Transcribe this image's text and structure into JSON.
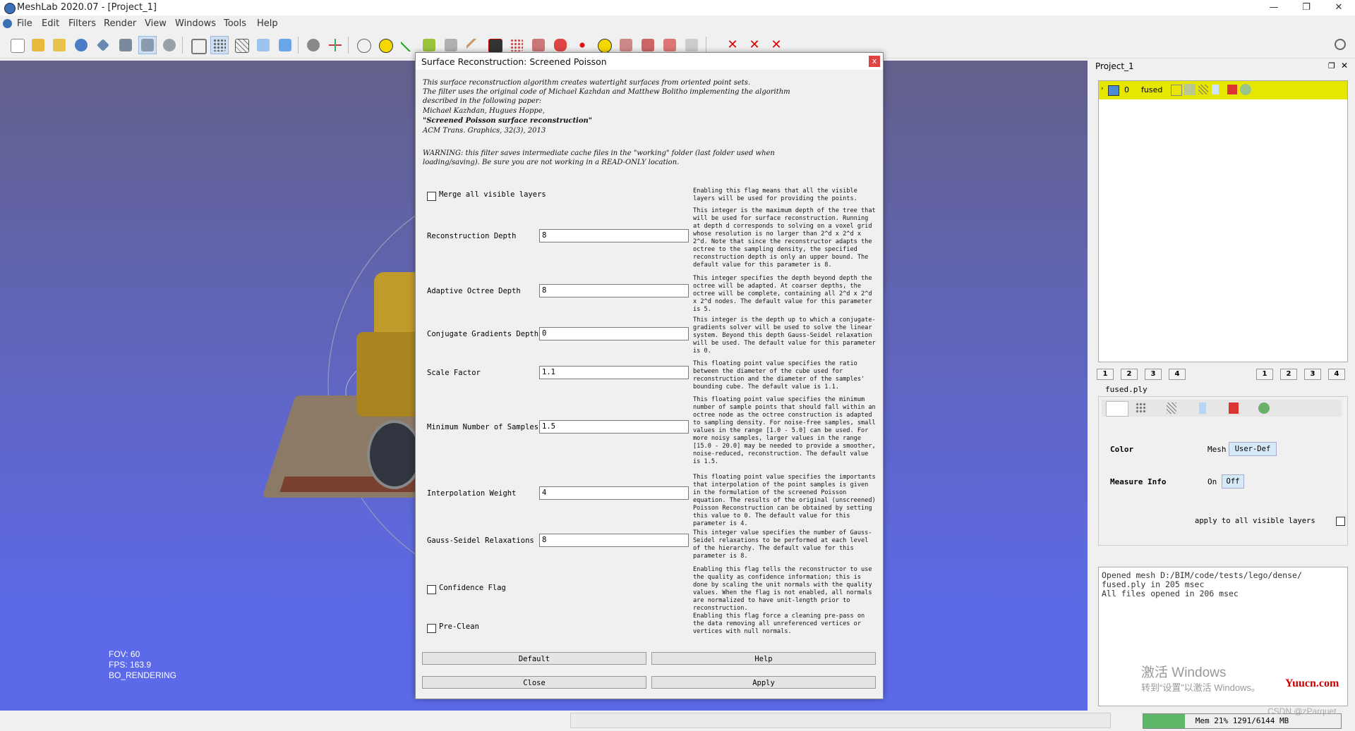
{
  "window": {
    "title": "MeshLab 2020.07 - [Project_1]",
    "min": "—",
    "max": "❐",
    "close": "✕"
  },
  "menu": [
    "File",
    "Edit",
    "Filters",
    "Render",
    "View",
    "Windows",
    "Tools",
    "Help"
  ],
  "viewport": {
    "fov": "FOV: 60",
    "fps": "FPS:  163.9",
    "mode": "BO_RENDERING"
  },
  "project": {
    "title": "Project_1",
    "layer_index": "0",
    "layer_name": "fused",
    "mesh_file": "fused.ply",
    "num_buttons": [
      "1",
      "2",
      "3",
      "4"
    ],
    "color_label": "Color",
    "color_mode": "Mesh",
    "color_value": "User-Def",
    "measure_label": "Measure Info",
    "measure_on": "On",
    "measure_off": "Off",
    "apply_all": "apply to all visible layers"
  },
  "log": [
    "Opened mesh D:/BIM/code/tests/lego/dense/",
    "fused.ply in 205 msec",
    "All files opened in 206 msec"
  ],
  "watermark": {
    "line1": "激活 Windows",
    "line2": "转到“设置”以激活 Windows。",
    "site": "Yuucn.com",
    "author": "CSDN @zParquet"
  },
  "status": {
    "mem": "Mem 21% 1291/6144 MB",
    "mem_fraction": 0.21
  },
  "dialog": {
    "title": "Surface Reconstruction: Screened Poisson",
    "close": "x",
    "description": [
      "This surface reconstruction algorithm creates watertight surfaces from oriented point sets.",
      "The filter uses the original code of Michael Kazhdan and Matthew Bolitho implementing the algorithm",
      "described in the following paper:",
      "Michael Kazhdan, Hugues Hoppe,",
      "\"Screened Poisson surface reconstruction\"",
      "ACM Trans. Graphics, 32(3), 2013"
    ],
    "warning": [
      "WARNING: this filter saves intermediate cache files in the \"working\" folder (last folder used when",
      "loading/saving). Be sure you are not working in a READ-ONLY location."
    ],
    "params": [
      {
        "kind": "check",
        "label": "Merge all visible layers",
        "checked": false,
        "help": "Enabling this flag means that all the visible layers will be used for providing the points."
      },
      {
        "kind": "input",
        "label": "Reconstruction Depth",
        "value": "8",
        "help": "This integer is the maximum depth of the tree that will be used for surface reconstruction. Running at depth d corresponds to solving on a voxel grid whose resolution is no larger than 2^d x 2^d x 2^d. Note that since the reconstructor adapts the octree to the sampling density, the specified reconstruction depth is only an upper bound. The default value for this parameter is 8."
      },
      {
        "kind": "input",
        "label": "Adaptive Octree Depth",
        "value": "8",
        "help": "This integer specifies the depth beyond depth the octree will be adapted. At coarser depths, the octree will be complete, containing all 2^d x 2^d x 2^d nodes. The default value for this parameter is 5."
      },
      {
        "kind": "input",
        "label": "Conjugate Gradients Depth",
        "value": "0",
        "help": "This integer is the depth up to which a conjugate-gradients solver will be used to solve the linear system. Beyond this depth Gauss-Seidel relaxation will be used. The default value for this parameter is 0."
      },
      {
        "kind": "input",
        "label": "Scale Factor",
        "value": "1.1",
        "help": "This floating point value specifies the ratio between the diameter of the cube used for reconstruction and the diameter of the samples' bounding cube. The default value is 1.1."
      },
      {
        "kind": "input",
        "label": "Minimum Number of Samples",
        "value": "1.5",
        "help": "This floating point value specifies the minimum number of sample points that should fall within an octree node as the octree construction is adapted to sampling density. For noise-free samples, small values in the range [1.0 - 5.0] can be used. For more noisy samples, larger values in the range [15.0 - 20.0] may be needed to provide a smoother, noise-reduced, reconstruction. The default value is 1.5."
      },
      {
        "kind": "input",
        "label": "Interpolation Weight",
        "value": "4",
        "help": "This floating point value specifies the importants that interpolation of the point samples is given in the formulation of the screened Poisson equation. The results of the original (unscreened) Poisson Reconstruction can be obtained by setting this value to 0. The default value for this parameter is 4."
      },
      {
        "kind": "input",
        "label": "Gauss-Seidel Relaxations",
        "value": "8",
        "help": "This integer value specifies the number of Gauss-Seidel relaxations to be performed at each level of the hierarchy. The default value for this parameter is 8."
      },
      {
        "kind": "check",
        "label": "Confidence Flag",
        "checked": false,
        "help": "Enabling this flag tells the reconstructor to use the quality as confidence information; this is done by scaling the unit normals with the quality values. When the flag is not enabled, all normals are normalized to have unit-length prior to reconstruction."
      },
      {
        "kind": "check",
        "label": "Pre-Clean",
        "checked": false,
        "help": "Enabling this flag force a cleaning pre-pass on the data removing all unreferenced vertices or vertices with null normals."
      }
    ],
    "buttons": {
      "default": "Default",
      "help": "Help",
      "close": "Close",
      "apply": "Apply"
    }
  }
}
